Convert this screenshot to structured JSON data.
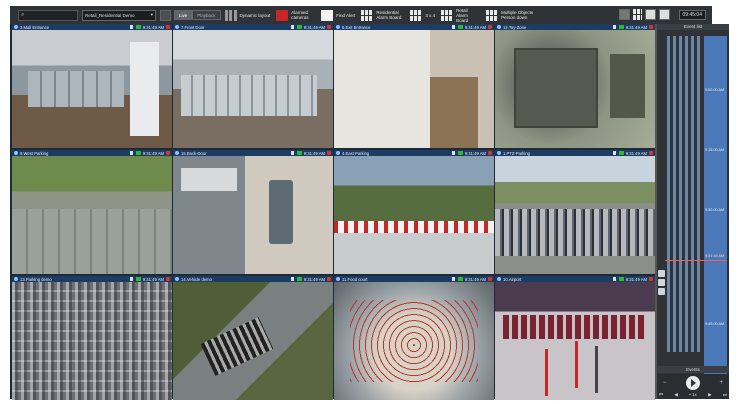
{
  "toolbar": {
    "search_placeholder": "",
    "site_select": "Retail_Residential Demo",
    "modes": [
      "Live",
      "Playback"
    ],
    "dynamic_layout": "Dynamic layout",
    "alarmed_cameras": "Alarmed cameras",
    "find_alert": "Find Alert",
    "residential_alarm_board": "Residential Alarm Board",
    "grid_label": "3 x 4",
    "retail_alarm_board": "Retail Alarm Board",
    "multiple_objects": "Multiple Objects Person down",
    "clock": "09:45:04"
  },
  "tiles": [
    {
      "name": "3.Mall Entrance",
      "time": "9:31:49 AM",
      "feed": "f-office"
    },
    {
      "name": "7.Front Door",
      "time": "9:31:49 AM",
      "feed": "f-office2"
    },
    {
      "name": "8.Exit Entrance",
      "time": "9:31:49 AM",
      "feed": "f-hall"
    },
    {
      "name": "12.Toy-Zone",
      "time": "9:31:49 AM",
      "feed": "f-sign"
    },
    {
      "name": "9.West Parking",
      "time": "9:31:49 AM",
      "feed": "f-parking"
    },
    {
      "name": "15.Back-Door",
      "time": "9:31:49 AM",
      "feed": "f-dock"
    },
    {
      "name": "4.East Parking",
      "time": "9:31:49 AM",
      "feed": "f-roof"
    },
    {
      "name": "1.PTZ-Parking",
      "time": "9:31:49 AM",
      "feed": "f-lot"
    },
    {
      "name": "13.Parking demo",
      "time": "9:31:49 AM",
      "feed": "f-aerial"
    },
    {
      "name": "14.Vehicle demo",
      "time": "9:31:49 AM",
      "feed": "f-road"
    },
    {
      "name": "11.Food court",
      "time": "9:31:49 AM",
      "feed": "f-food"
    },
    {
      "name": "10.Airport",
      "time": "9:31:49 AM",
      "feed": "f-airport"
    }
  ],
  "sidebar": {
    "header": "Event list",
    "timeline_labels": [
      "9:00:00 AM",
      "9:15:00 AM",
      "9:30:00 AM",
      "9:45:00 AM"
    ],
    "cursor_label": "9:31:49 AM",
    "events_label": "Events",
    "controls": [
      "⏮",
      "◀",
      "• 1x",
      "▶",
      "⏭"
    ]
  },
  "colors": {
    "accent": "#1d3c63",
    "alarm": "#d32f2f",
    "live": "#2eb82e",
    "timeline": "#4a78b8"
  }
}
